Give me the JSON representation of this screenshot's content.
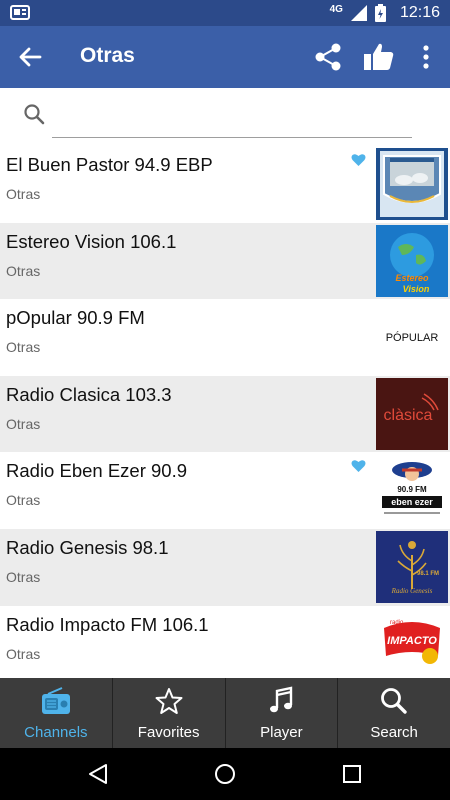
{
  "status_bar": {
    "network": "4G",
    "time": "12:16"
  },
  "app_bar": {
    "title": "Otras"
  },
  "search": {
    "placeholder": "",
    "value": ""
  },
  "colors": {
    "primary": "#3b5fa8",
    "status_bar": "#2c4a8a",
    "accent": "#4fb3ea",
    "bottom_nav": "#3c3c3c"
  },
  "stations": [
    {
      "name": "El Buen Pastor 94.9 EBP",
      "category": "Otras",
      "favorite": true,
      "logo": "el-buen-pastor-logo"
    },
    {
      "name": "Estereo Vision 106.1",
      "category": "Otras",
      "favorite": false,
      "logo": "estereo-vision-logo"
    },
    {
      "name": "pOpular 90.9 FM",
      "category": "Otras",
      "favorite": false,
      "logo": "popular-logo"
    },
    {
      "name": "Radio Clasica 103.3",
      "category": "Otras",
      "favorite": false,
      "logo": "clasica-logo"
    },
    {
      "name": "Radio Eben Ezer 90.9",
      "category": "Otras",
      "favorite": true,
      "logo": "eben-ezer-logo"
    },
    {
      "name": "Radio Genesis 98.1",
      "category": "Otras",
      "favorite": false,
      "logo": "radio-genesis-logo"
    },
    {
      "name": "Radio Impacto FM 106.1",
      "category": "Otras",
      "favorite": false,
      "logo": "radio-impacto-logo"
    }
  ],
  "logos": {
    "popular": "PÓPULAR",
    "clasica": "clàsica",
    "eben_ezer_freq": "90.9 FM",
    "eben_ezer_name": "eben ezer",
    "genesis_freq": "98.1 FM",
    "genesis_name": "Radio Genesis",
    "impacto": "IMPACTO",
    "vision": "Vision"
  },
  "bottom_nav": [
    {
      "label": "Channels",
      "icon": "radio-icon",
      "active": true
    },
    {
      "label": "Favorites",
      "icon": "star-icon",
      "active": false
    },
    {
      "label": "Player",
      "icon": "music-note-icon",
      "active": false
    },
    {
      "label": "Search",
      "icon": "search-icon",
      "active": false
    }
  ]
}
